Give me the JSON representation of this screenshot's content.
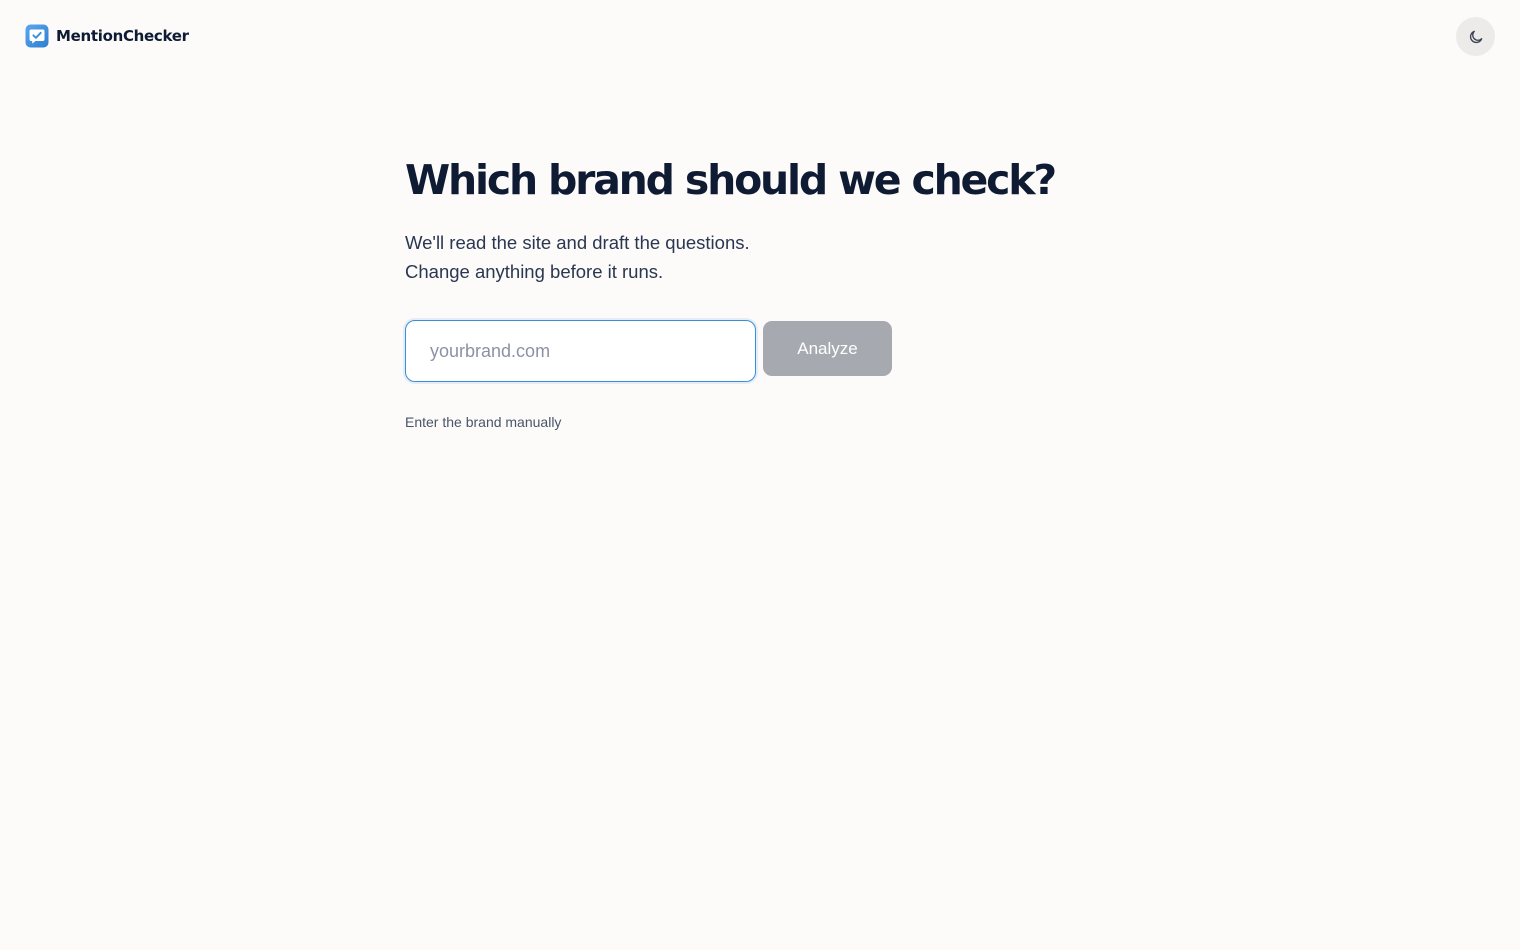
{
  "header": {
    "brand_name": "MentionChecker",
    "logo_icon": "chat-check-icon",
    "theme_toggle_icon": "moon-icon"
  },
  "main": {
    "title": "Which brand should we check?",
    "subtitle_line1": "We'll read the site and draft the questions.",
    "subtitle_line2": "Change anything before it runs.",
    "input_value": "",
    "input_placeholder": "yourbrand.com",
    "analyze_label": "Analyze",
    "manual_link": "Enter the brand manually"
  },
  "colors": {
    "background": "#fcfbfa",
    "text_primary": "#0f1b33",
    "accent_blue": "#3b8ed8",
    "button_disabled": "#a6a9af",
    "toggle_bg": "#ecebe9"
  }
}
